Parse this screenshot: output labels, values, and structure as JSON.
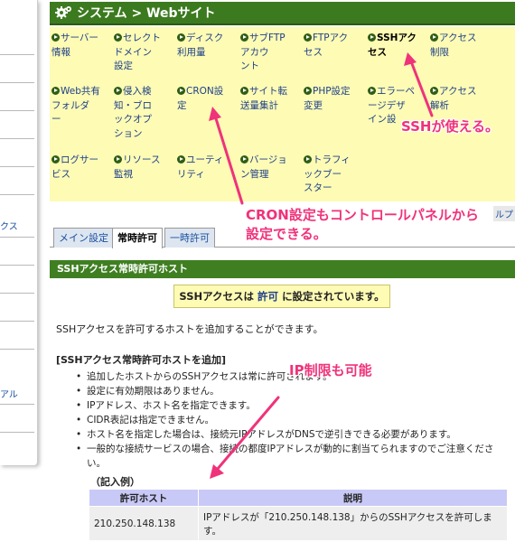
{
  "header": {
    "title": "システム > Webサイト",
    "icon": "gear-icon"
  },
  "left_panel": {
    "texts": [
      "クス",
      "アル"
    ]
  },
  "menu": {
    "items": [
      {
        "label": "サーバー情報",
        "lines": [
          "サーバー",
          "情報"
        ]
      },
      {
        "label": "セレクトドメイン設定",
        "lines": [
          "セレクト",
          "ドメイン",
          "設定"
        ]
      },
      {
        "label": "ディスク利用量",
        "lines": [
          "ディスク",
          "利用量"
        ]
      },
      {
        "label": "サブFTPアカウント",
        "lines": [
          "サブFTP",
          "アカウ",
          "ント"
        ]
      },
      {
        "label": "FTPアクセス",
        "lines": [
          "FTPアク",
          "セス"
        ]
      },
      {
        "label": "SSHアクセス",
        "lines": [
          "SSHアク",
          "セス"
        ],
        "highlight": true
      },
      {
        "label": "アクセス制限",
        "lines": [
          "アクセス",
          "制限"
        ]
      },
      {
        "label": "Web共有フォルダー",
        "lines": [
          "Web共有",
          "フォルダ",
          "ー"
        ]
      },
      {
        "label": "侵入検知・ブロックオプション",
        "lines": [
          "侵入検",
          "知・ブロ",
          "ックオプ",
          "ション"
        ]
      },
      {
        "label": "CRON設定",
        "lines": [
          "CRON設",
          "定"
        ]
      },
      {
        "label": "サイト転送量集計",
        "lines": [
          "サイト転",
          "送量集計"
        ]
      },
      {
        "label": "PHP設定変更",
        "lines": [
          "PHP設定",
          "変更"
        ]
      },
      {
        "label": "エラーページデザイン設定",
        "lines": [
          "エラーペ",
          "ージデザ",
          "イン設"
        ]
      },
      {
        "label": "アクセス解析",
        "lines": [
          "アクセス",
          "解析"
        ]
      },
      {
        "label": "ログサービス",
        "lines": [
          "ログサー",
          "ビス"
        ]
      },
      {
        "label": "リソース監視",
        "lines": [
          "リソース",
          "監視"
        ]
      },
      {
        "label": "ユーティリティ",
        "lines": [
          "ユーティ",
          "リティ"
        ]
      },
      {
        "label": "バージョン管理",
        "lines": [
          "バージョ",
          "ン管理"
        ]
      },
      {
        "label": "トラフィックブースター",
        "lines": [
          "トラフィ",
          "ックブー",
          "スター"
        ]
      }
    ]
  },
  "help_label": "ルプ",
  "tabs": [
    {
      "label": "メイン設定",
      "active": false
    },
    {
      "label": "常時許可",
      "active": true
    },
    {
      "label": "一時許可",
      "active": false
    }
  ],
  "content": {
    "section_title": "SSHアクセス常時許可ホスト",
    "status_prefix": "SSHアクセスは",
    "status_value": "許可",
    "status_suffix": "に設定されています。",
    "intro": "SSHアクセスを許可するホストを追加することができます。",
    "add_heading": "[SSHアクセス常時許可ホストを追加]",
    "rules": [
      "追加したホストからのSSHアクセスは常に許可されます。",
      "設定に有効期限はありません。",
      "IPアドレス、ホスト名を指定できます。",
      "CIDR表記は指定できません。",
      "ホスト名を指定した場合は、接続元IPアドレスがDNSで逆引きできる必要があります。",
      "一般的な接続サービスの場合、接続の都度IPアドレスが動的に割当てられますのでご注意ください。"
    ],
    "example_label": "（記入例）",
    "table": {
      "headers": [
        "許可ホスト",
        "説明"
      ],
      "rows": [
        [
          "210.250.148.138",
          "IPアドレスが「210.250.148.138」からのSSHアクセスを許可します。"
        ]
      ]
    }
  },
  "annotations": {
    "ssh": "SSHが使える。",
    "cron_line1": "CRON設定もコントロールパネルから",
    "cron_line2": "設定できる。",
    "ip": "IP制限も可能"
  },
  "colors": {
    "header_green": "#3c7a1f",
    "menu_yellow": "#fdfbb4",
    "annotation_pink": "#f0327a",
    "table_header": "#c9c9f7"
  }
}
